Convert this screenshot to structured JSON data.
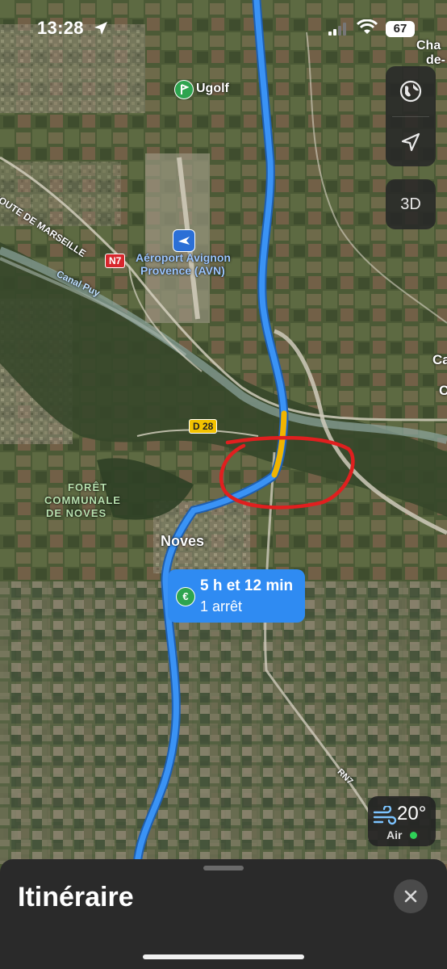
{
  "status_bar": {
    "time": "13:28",
    "battery": "67"
  },
  "map": {
    "labels": {
      "ugolf": "Ugolf",
      "airport_line1": "Aéroport Avignon",
      "airport_line2": "Provence (AVN)",
      "route_de_marseille": "ROUTE DE MARSEILLE",
      "canal_puy": "Canal Puy",
      "foret_line1": "FORÊT",
      "foret_line2": "COMMUNALE",
      "foret_line3": "DE NOVES",
      "noves": "Noves",
      "edge_top_right_1": "Cha",
      "edge_top_right_2": "de-",
      "edge_right_ca": "Ca",
      "edge_right_c": "C"
    },
    "road_shields": {
      "n7": "N7",
      "d28": "D 28",
      "rn7": "RN7"
    }
  },
  "controls": {
    "globe_icon": "globe-icon",
    "locate_icon": "location-arrow-icon",
    "btn_3d": "3D"
  },
  "route_callout": {
    "icon": "€",
    "duration": "5 h et 12 min",
    "stops": "1 arrêt"
  },
  "weather": {
    "temperature": "20°",
    "air_label": "Air",
    "air_quality_color": "#2fd158"
  },
  "sheet": {
    "title": "Itinéraire"
  },
  "colors": {
    "route": "#2f8bf2",
    "route_highlight": "#f0b400",
    "annotation_circle": "#e01f1f"
  }
}
